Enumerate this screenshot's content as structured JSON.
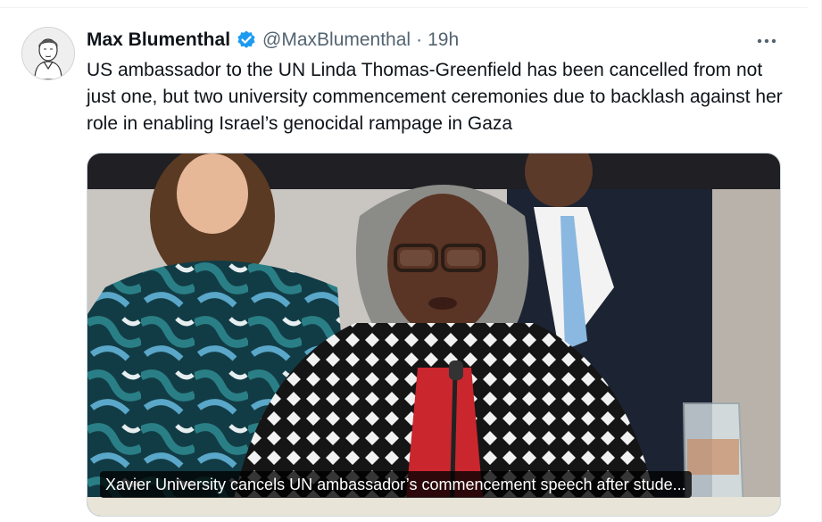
{
  "author": {
    "display_name": "Max Blumenthal",
    "handle": "@MaxBlumenthal",
    "separator": "·",
    "timestamp": "19h",
    "verified_icon": "verified-badge-icon",
    "verified_color": "#1d9bf0"
  },
  "tweet": {
    "text": "US ambassador to the UN Linda Thomas-Greenfield has been cancelled from not just one, but two university commencement ceremonies due to backlash against her role in enabling Israel’s genocidal rampage in Gaza"
  },
  "media": {
    "caption": "Xavier University cancels UN ambassador’s commencement speech after stude..."
  },
  "colors": {
    "text_primary": "#0f1419",
    "text_secondary": "#536471",
    "verified_blue": "#1d9bf0"
  },
  "icons": {
    "more": "more-dots-icon"
  }
}
